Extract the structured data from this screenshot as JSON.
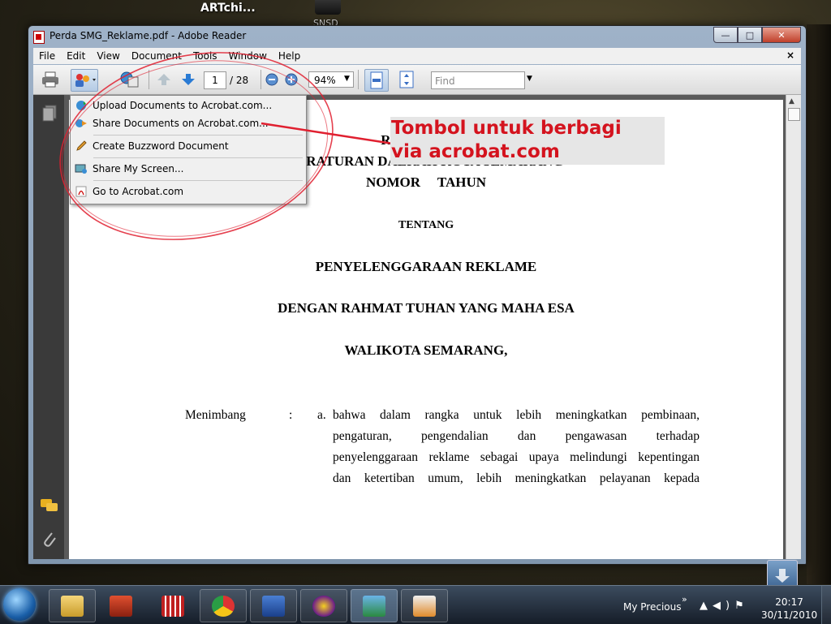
{
  "desktop": {
    "label": "ARTchi...",
    "icon_label": "SNSD"
  },
  "window": {
    "title": "Perda SMG_Reklame.pdf - Adobe Reader",
    "buttons": {
      "minimize": "—",
      "maximize": "□",
      "close": "✕"
    }
  },
  "menubar": {
    "items": [
      "File",
      "Edit",
      "View",
      "Document",
      "Tools",
      "Window",
      "Help"
    ],
    "close_glyph": "×"
  },
  "toolbar": {
    "page_current": "1",
    "page_total": "/ 28",
    "zoom": "94%",
    "find_placeholder": "Find"
  },
  "share_menu": {
    "items": [
      "Upload Documents to Acrobat.com...",
      "Share Documents on Acrobat.com...",
      "Create Buzzword Document",
      "Share My Screen...",
      "Go to Acrobat.com"
    ]
  },
  "annotation": {
    "line1": "Tombol untuk berbagi",
    "line2": "via acrobat.com",
    "color": "#d4131e"
  },
  "document": {
    "heading1": "RANCANGAN",
    "heading2": "PERATURAN DAERAH KOTA SEMARANG",
    "heading3": "NOMOR     TAHUN",
    "tentang": "TENTANG",
    "subject": "PENYELENGGARAAN REKLAME",
    "rahmat": "DENGAN RAHMAT TUHAN YANG MAHA ESA",
    "walikota": "WALIKOTA SEMARANG,",
    "menimbang_label": "Menimbang",
    "colon": ":",
    "item_letter": "a.",
    "para_lines": [
      "bahwa dalam rangka untuk lebih meningkatkan pembinaan,",
      "pengaturan, pengendalian dan pengawasan terhadap",
      "penyelenggaraan reklame sebagai upaya melindungi kepentingan",
      "dan ketertiban umum, lebih meningkatkan pelayanan kepada"
    ]
  },
  "taskbar": {
    "user": "My Precious",
    "chevron": "»",
    "time": "20:17",
    "date": "30/11/2010"
  }
}
